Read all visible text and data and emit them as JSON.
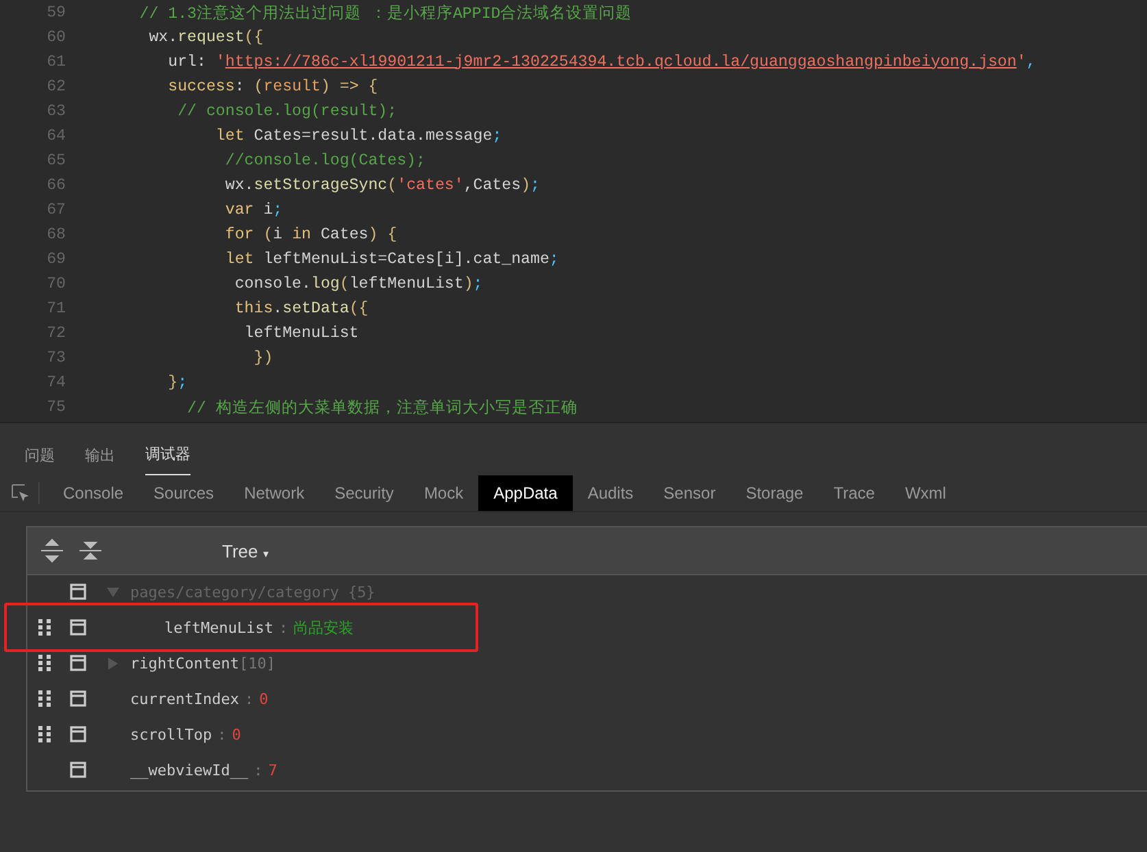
{
  "editor": {
    "lines": [
      {
        "number": "59",
        "tokens": [
          {
            "kind": "comment",
            "text": "      // 1.3注意这个用法出过问题 ：是小程序APPID合法域名设置问题"
          }
        ]
      },
      {
        "number": "60",
        "tokens": [
          {
            "kind": "plain",
            "text": "       wx."
          },
          {
            "kind": "func",
            "text": "request"
          },
          {
            "kind": "paren",
            "text": "({"
          }
        ]
      },
      {
        "number": "61",
        "tokens": [
          {
            "kind": "plain",
            "text": "         url: "
          },
          {
            "kind": "string",
            "text": "'"
          },
          {
            "kind": "link",
            "text": "https://786c-xl19901211-j9mr2-1302254394.tcb.qcloud.la/guanggaoshangpinbeiyong.json"
          },
          {
            "kind": "string",
            "text": "'"
          },
          {
            "kind": "punct",
            "text": ","
          }
        ]
      },
      {
        "number": "62",
        "tokens": [
          {
            "kind": "keyword",
            "text": "         success"
          },
          {
            "kind": "plain",
            "text": ": "
          },
          {
            "kind": "paren",
            "text": "("
          },
          {
            "kind": "param",
            "text": "result"
          },
          {
            "kind": "paren",
            "text": ")"
          },
          {
            "kind": "keyword",
            "text": " => "
          },
          {
            "kind": "paren",
            "text": "{"
          }
        ]
      },
      {
        "number": "63",
        "tokens": [
          {
            "kind": "comment",
            "text": "          // console.log(result);"
          }
        ]
      },
      {
        "number": "64",
        "tokens": [
          {
            "kind": "keyword",
            "text": "              let"
          },
          {
            "kind": "plain",
            "text": " Cates=result.data.message"
          },
          {
            "kind": "punct",
            "text": ";"
          }
        ]
      },
      {
        "number": "65",
        "tokens": [
          {
            "kind": "comment",
            "text": "               //console.log(Cates);"
          }
        ]
      },
      {
        "number": "66",
        "tokens": [
          {
            "kind": "plain",
            "text": "               wx."
          },
          {
            "kind": "func",
            "text": "setStorageSync"
          },
          {
            "kind": "paren",
            "text": "("
          },
          {
            "kind": "string",
            "text": "'cates'"
          },
          {
            "kind": "plain",
            "text": ",Cates"
          },
          {
            "kind": "paren",
            "text": ")"
          },
          {
            "kind": "punct",
            "text": ";"
          }
        ]
      },
      {
        "number": "67",
        "tokens": [
          {
            "kind": "keyword",
            "text": "               var"
          },
          {
            "kind": "plain",
            "text": " i"
          },
          {
            "kind": "punct",
            "text": ";"
          }
        ]
      },
      {
        "number": "68",
        "tokens": [
          {
            "kind": "keyword",
            "text": "               for "
          },
          {
            "kind": "paren",
            "text": "("
          },
          {
            "kind": "plain",
            "text": "i "
          },
          {
            "kind": "keyword",
            "text": "in"
          },
          {
            "kind": "plain",
            "text": " Cates"
          },
          {
            "kind": "paren",
            "text": ")"
          },
          {
            "kind": "paren",
            "text": " {"
          }
        ]
      },
      {
        "number": "69",
        "tokens": [
          {
            "kind": "keyword",
            "text": "               let"
          },
          {
            "kind": "plain",
            "text": " leftMenuList=Cates[i].cat_name"
          },
          {
            "kind": "punct",
            "text": ";"
          }
        ]
      },
      {
        "number": "70",
        "tokens": [
          {
            "kind": "plain",
            "text": "                console."
          },
          {
            "kind": "func",
            "text": "log"
          },
          {
            "kind": "paren",
            "text": "("
          },
          {
            "kind": "plain",
            "text": "leftMenuList"
          },
          {
            "kind": "paren",
            "text": ")"
          },
          {
            "kind": "punct",
            "text": ";"
          }
        ]
      },
      {
        "number": "71",
        "tokens": [
          {
            "kind": "keyword",
            "text": "                this"
          },
          {
            "kind": "plain",
            "text": "."
          },
          {
            "kind": "func",
            "text": "setData"
          },
          {
            "kind": "paren",
            "text": "({"
          }
        ]
      },
      {
        "number": "72",
        "tokens": [
          {
            "kind": "plain",
            "text": "                 leftMenuList"
          }
        ]
      },
      {
        "number": "73",
        "tokens": [
          {
            "kind": "paren",
            "text": "                  })"
          }
        ]
      },
      {
        "number": "74",
        "tokens": [
          {
            "kind": "paren",
            "text": "         }"
          },
          {
            "kind": "punct",
            "text": ";"
          }
        ]
      },
      {
        "number": "75",
        "tokens": [
          {
            "kind": "comment",
            "text": "           // 构造左侧的大菜单数据，注意单词大小写是否正确"
          }
        ]
      }
    ]
  },
  "panel_tabs": [
    {
      "label": "问题",
      "selected": false
    },
    {
      "label": "输出",
      "selected": false
    },
    {
      "label": "调试器",
      "selected": true
    }
  ],
  "devtools_tabs": [
    {
      "label": "Console",
      "selected": false
    },
    {
      "label": "Sources",
      "selected": false
    },
    {
      "label": "Network",
      "selected": false
    },
    {
      "label": "Security",
      "selected": false
    },
    {
      "label": "Mock",
      "selected": false
    },
    {
      "label": "AppData",
      "selected": true
    },
    {
      "label": "Audits",
      "selected": false
    },
    {
      "label": "Sensor",
      "selected": false
    },
    {
      "label": "Storage",
      "selected": false
    },
    {
      "label": "Trace",
      "selected": false
    },
    {
      "label": "Wxml",
      "selected": false
    }
  ],
  "appdata": {
    "view_menu": "Tree",
    "view_menu_caret": "▾",
    "rows": [
      {
        "key": "pages/category/category {5}",
        "kind": "root",
        "draggable": false,
        "expanded": true,
        "highlighted": false
      },
      {
        "key": "leftMenuList",
        "kind": "string",
        "separator": ":",
        "value": "尚品安装",
        "draggable": true,
        "highlighted": true
      },
      {
        "key": "rightContent",
        "kind": "array",
        "value": "[10]",
        "draggable": true,
        "expanded": false,
        "highlighted": false
      },
      {
        "key": "currentIndex",
        "kind": "number",
        "separator": ":",
        "value": "0",
        "draggable": true,
        "highlighted": false
      },
      {
        "key": "scrollTop",
        "kind": "number",
        "separator": ":",
        "value": "0",
        "draggable": true,
        "highlighted": false
      },
      {
        "key": "__webviewId__",
        "kind": "number",
        "separator": ":",
        "value": "7",
        "draggable": false,
        "highlighted": false
      }
    ]
  }
}
